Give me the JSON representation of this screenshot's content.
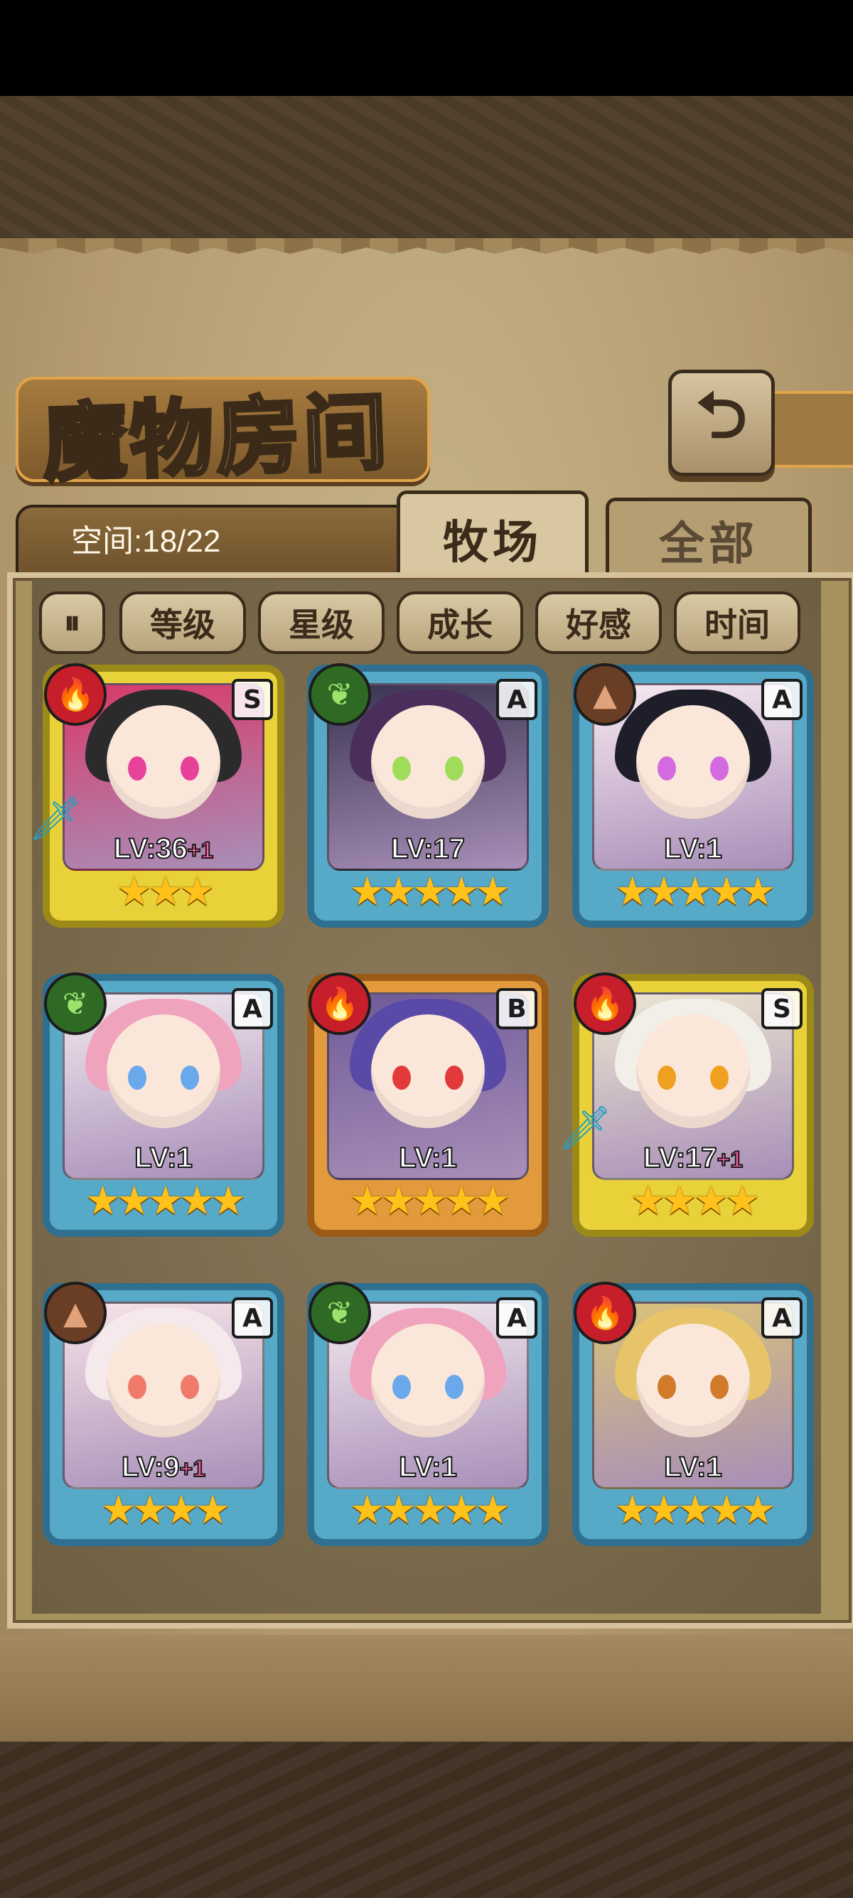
{
  "header": {
    "title": "魔物房间",
    "back_icon": "back-arrow-icon"
  },
  "tabs": {
    "space_label": "空间:18/22",
    "active": "牧场",
    "inactive": "全部"
  },
  "sort": {
    "toggle_icon": "pause-sort-icon",
    "buttons": [
      "等级",
      "星级",
      "成长",
      "好感",
      "时间"
    ]
  },
  "monsters": [
    {
      "level": "LV:36",
      "bonus": "+1",
      "rank": "S",
      "element": "fire",
      "frame": "gold",
      "stars": "★★★",
      "weapon": "sword-icon"
    },
    {
      "level": "LV:17",
      "bonus": "",
      "rank": "A",
      "element": "leaf",
      "frame": "blue",
      "stars": "★★★★★",
      "weapon": ""
    },
    {
      "level": "LV:1",
      "bonus": "",
      "rank": "A",
      "element": "rock",
      "frame": "blue",
      "stars": "★★★★★",
      "weapon": ""
    },
    {
      "level": "LV:1",
      "bonus": "",
      "rank": "A",
      "element": "leaf",
      "frame": "blue",
      "stars": "★★★★★",
      "weapon": ""
    },
    {
      "level": "LV:1",
      "bonus": "",
      "rank": "B",
      "element": "fire",
      "frame": "orange",
      "stars": "★★★★★",
      "weapon": ""
    },
    {
      "level": "LV:17",
      "bonus": "+1",
      "rank": "S",
      "element": "fire",
      "frame": "gold",
      "stars": "★★★★",
      "weapon": "sword-icon"
    },
    {
      "level": "LV:9",
      "bonus": "+1",
      "rank": "A",
      "element": "rock",
      "frame": "blue",
      "stars": "★★★★",
      "weapon": ""
    },
    {
      "level": "LV:1",
      "bonus": "",
      "rank": "A",
      "element": "leaf",
      "frame": "blue",
      "stars": "★★★★★",
      "weapon": ""
    },
    {
      "level": "LV:1",
      "bonus": "",
      "rank": "A",
      "element": "fire",
      "frame": "blue",
      "stars": "★★★★★",
      "weapon": ""
    }
  ],
  "colors": {
    "fire": "#c61e2a",
    "leaf": "#2f6a25",
    "rock": "#6a3d25",
    "star": "#ffc21a"
  }
}
